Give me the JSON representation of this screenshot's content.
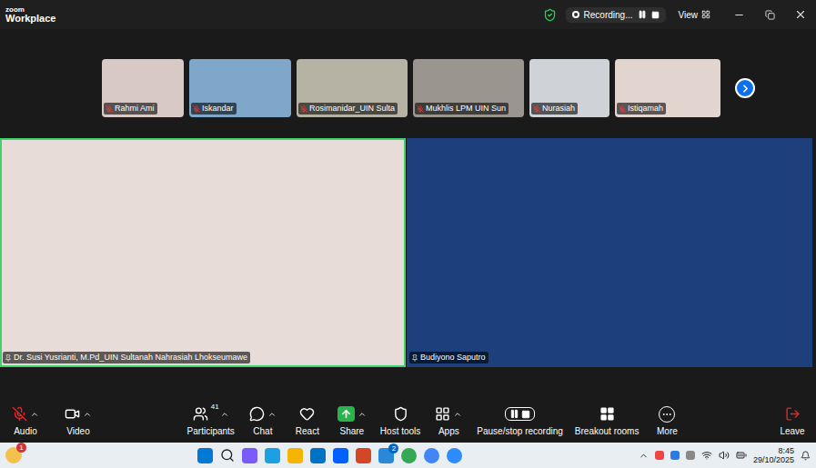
{
  "window": {
    "logo": "zoom",
    "title": "Workplace"
  },
  "recording": {
    "label": "Recording...",
    "paused": false
  },
  "view": {
    "label": "View"
  },
  "gallery": [
    {
      "name": "Rahmi Ami",
      "muted": true
    },
    {
      "name": "Iskandar",
      "muted": true
    },
    {
      "name": "Rosimanidar_UIN Sulta",
      "muted": true
    },
    {
      "name": "Mukhlis LPM UIN Sun",
      "muted": true
    },
    {
      "name": "Nurasiah",
      "muted": true
    },
    {
      "name": "Istiqamah",
      "muted": true
    }
  ],
  "speakers": [
    {
      "name": "Dr. Susi Yusrianti, M.Pd_UIN Sultanah Nahrasiah Lhokseumawe",
      "pinned": true,
      "active": true
    },
    {
      "name": "Budiyono Saputro",
      "pinned": true,
      "active": false
    }
  ],
  "toolbar": [
    {
      "kind": "audio",
      "label": "Audio",
      "muted": true,
      "caret": true
    },
    {
      "kind": "video",
      "label": "Video",
      "caret": true
    },
    {
      "kind": "participants",
      "label": "Participants",
      "count": "41",
      "caret": true
    },
    {
      "kind": "chat",
      "label": "Chat",
      "caret": true
    },
    {
      "kind": "react",
      "label": "React",
      "caret": false
    },
    {
      "kind": "share",
      "label": "Share",
      "caret": true
    },
    {
      "kind": "host",
      "label": "Host tools",
      "caret": false
    },
    {
      "kind": "apps",
      "label": "Apps",
      "caret": true
    },
    {
      "kind": "recording",
      "label": "Pause/stop recording",
      "caret": false
    },
    {
      "kind": "breakout",
      "label": "Breakout rooms",
      "caret": false
    },
    {
      "kind": "more",
      "label": "More",
      "caret": false
    },
    {
      "kind": "leave",
      "label": "Leave",
      "caret": false
    }
  ],
  "taskbar": {
    "notification_badge": "1",
    "app_badge": "2",
    "time": "8:45",
    "date": "29/10/2025"
  }
}
